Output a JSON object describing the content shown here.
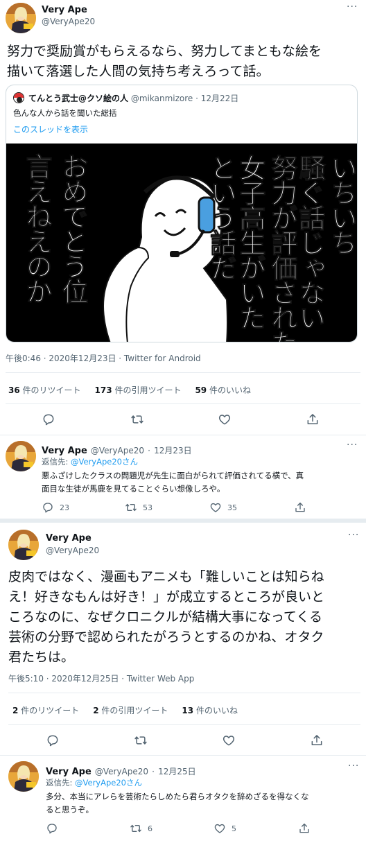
{
  "tweet1": {
    "name": "Very Ape",
    "handle": "@VeryApe20",
    "text_line1": "努力で奨励賞がもらえるなら、努力してまともな絵を",
    "text_line2": "描いて落選した人間の気持ち考えろって話。",
    "quote": {
      "name": "てんとう武士@クソ絵の人",
      "handle": "@mikanmizore",
      "date": "12月22日",
      "text": "色んな人から話を聞いた総括",
      "thread_link": "このスレッドを表示",
      "image_columns": [
        "いちいち",
        "騒ぐ話じゃない",
        "努力が評価された",
        "女子高生がいた",
        "という話だ",
        "おめでとう位",
        "言えねえのか"
      ]
    },
    "timestamp": "午後0:46 · 2020年12月23日 · Twitter for Android",
    "retweets_count": "36",
    "retweets_label": "件のリツイート",
    "quotes_count": "173",
    "quotes_label": "件の引用ツイート",
    "likes_count": "59",
    "likes_label": "件のいいね"
  },
  "reply1": {
    "name": "Very Ape",
    "handle": "@VeryApe20",
    "date": "12月23日",
    "reply_to_prefix": "返信先: ",
    "reply_to_handle": "@VeryApe20さん",
    "text_line1": "悪ふざけしたクラスの問題児が先生に面白がられて評価されてる横で、真",
    "text_line2": "面目な生徒が馬鹿を見てることぐらい想像しろや。",
    "reply_count": "23",
    "retweet_count": "53",
    "like_count": "35"
  },
  "tweet2": {
    "name": "Very Ape",
    "handle": "@VeryApe20",
    "text_lines": [
      "皮肉ではなく、漫画もアニメも「難しいことは知らね",
      "え！好きなもんは好き！」が成立するところが良いと",
      "ころなのに、なぜクロニクルが結構大事になってくる",
      "芸術の分野で認められたがろうとするのかね、オタク",
      "君たちは。"
    ],
    "timestamp": "午後5:10 · 2020年12月25日 · Twitter Web App",
    "retweets_count": "2",
    "retweets_label": "件のリツイート",
    "quotes_count": "2",
    "quotes_label": "件の引用ツイート",
    "likes_count": "13",
    "likes_label": "件のいいね"
  },
  "reply2": {
    "name": "Very Ape",
    "handle": "@VeryApe20",
    "date": "12月25日",
    "reply_to_prefix": "返信先: ",
    "reply_to_handle": "@VeryApe20さん",
    "text_line1": "多分、本当にアレらを芸術たらしめたら君らオタクを辞めざるを得なくな",
    "text_line2": "ると思うぞ。",
    "retweet_count": "6",
    "like_count": "5"
  },
  "icons": {
    "more": "more-horizontal-icon",
    "reply": "reply-icon",
    "retweet": "retweet-icon",
    "like": "heart-icon",
    "share": "share-icon"
  },
  "colors": {
    "accent": "#1d9bf0",
    "text_secondary": "#536471",
    "divider": "#e6ecf0"
  }
}
